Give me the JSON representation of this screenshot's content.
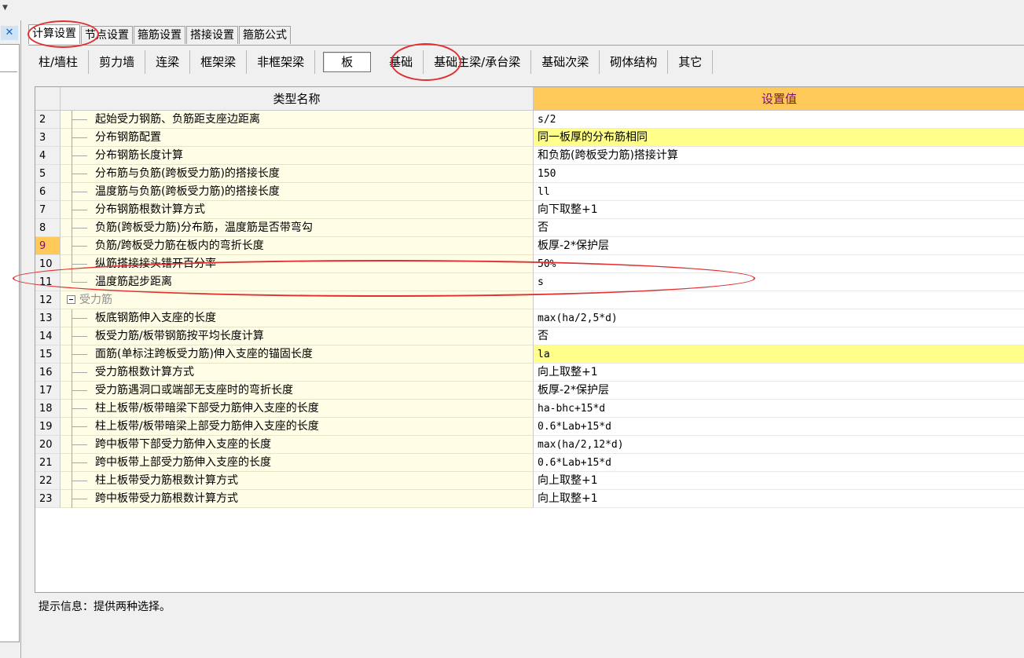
{
  "tabs_top": [
    "计算设置",
    "节点设置",
    "箍筋设置",
    "搭接设置",
    "箍筋公式"
  ],
  "tabs_member": [
    "柱/墙柱",
    "剪力墙",
    "连梁",
    "框架梁",
    "非框架梁",
    "板",
    "基础",
    "基础主梁/承台梁",
    "基础次梁",
    "砌体结构",
    "其它"
  ],
  "grid": {
    "header_name": "类型名称",
    "header_value": "设置值",
    "rows": [
      {
        "num": "2",
        "name": "起始受力钢筋、负筋距支座边距离",
        "value": "s/2"
      },
      {
        "num": "3",
        "name": "分布钢筋配置",
        "value": "同一板厚的分布筋相同"
      },
      {
        "num": "4",
        "name": "分布钢筋长度计算",
        "value": "和负筋(跨板受力筋)搭接计算"
      },
      {
        "num": "5",
        "name": "分布筋与负筋(跨板受力筋)的搭接长度",
        "value": "150"
      },
      {
        "num": "6",
        "name": "温度筋与负筋(跨板受力筋)的搭接长度",
        "value": "ll"
      },
      {
        "num": "7",
        "name": "分布钢筋根数计算方式",
        "value": "向下取整+1"
      },
      {
        "num": "8",
        "name": "负筋(跨板受力筋)分布筋，温度筋是否带弯勾",
        "value": "否"
      },
      {
        "num": "9",
        "name": "负筋/跨板受力筋在板内的弯折长度",
        "value": "板厚-2*保护层"
      },
      {
        "num": "10",
        "name": "纵筋搭接接头错开百分率",
        "value": "50%"
      },
      {
        "num": "11",
        "name": "温度筋起步距离",
        "value": "s"
      },
      {
        "num": "12",
        "name": "受力筋",
        "value": ""
      },
      {
        "num": "13",
        "name": "板底钢筋伸入支座的长度",
        "value": "max(ha/2,5*d)"
      },
      {
        "num": "14",
        "name": "板受力筋/板带钢筋按平均长度计算",
        "value": "否"
      },
      {
        "num": "15",
        "name": "面筋(单标注跨板受力筋)伸入支座的锚固长度",
        "value": "la"
      },
      {
        "num": "16",
        "name": "受力筋根数计算方式",
        "value": "向上取整+1"
      },
      {
        "num": "17",
        "name": "受力筋遇洞口或端部无支座时的弯折长度",
        "value": "板厚-2*保护层"
      },
      {
        "num": "18",
        "name": "柱上板带/板带暗梁下部受力筋伸入支座的长度",
        "value": "ha-bhc+15*d"
      },
      {
        "num": "19",
        "name": "柱上板带/板带暗梁上部受力筋伸入支座的长度",
        "value": "0.6*Lab+15*d"
      },
      {
        "num": "20",
        "name": "跨中板带下部受力筋伸入支座的长度",
        "value": "max(ha/2,12*d)"
      },
      {
        "num": "21",
        "name": "跨中板带上部受力筋伸入支座的长度",
        "value": "0.6*Lab+15*d"
      },
      {
        "num": "22",
        "name": "柱上板带受力筋根数计算方式",
        "value": "向上取整+1"
      },
      {
        "num": "23",
        "name": "跨中板带受力筋根数计算方式",
        "value": "向上取整+1"
      }
    ]
  },
  "hint": "提示信息：提供两种选择。",
  "colors": {
    "accent": "#ffc95a",
    "highlight": "#ffff8a",
    "annotation": "#e03030"
  }
}
